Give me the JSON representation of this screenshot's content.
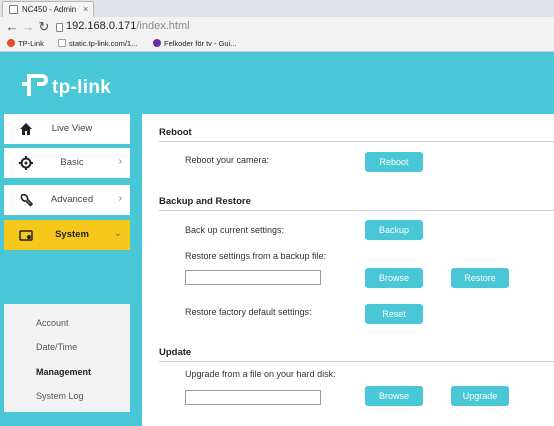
{
  "browser": {
    "tab_title": "NC450 - Admin",
    "url_host": "192.168.0.171",
    "url_path": "/index.html",
    "bookmarks": [
      {
        "label": "TP-Link",
        "color": "#e64b2a"
      },
      {
        "label": "static.tp-link.com/1...",
        "color": "#9aa3ad"
      },
      {
        "label": "Felkoder för tv - Gui...",
        "color": "#6b2fa0"
      }
    ]
  },
  "logo": {
    "text": "tp-link"
  },
  "sidebar": {
    "items": [
      {
        "label": "Live View",
        "icon": "home-icon"
      },
      {
        "label": "Basic",
        "icon": "gear-icon"
      },
      {
        "label": "Advanced",
        "icon": "wrench-icon"
      },
      {
        "label": "System",
        "icon": "system-icon"
      }
    ],
    "submenu": [
      "Account",
      "Date/Time",
      "Management",
      "System Log"
    ]
  },
  "content": {
    "reboot": {
      "title": "Reboot",
      "label": "Reboot your camera:",
      "button": "Reboot"
    },
    "backup": {
      "title": "Backup and Restore",
      "backup_label": "Back up current settings:",
      "backup_button": "Backup",
      "restore_label": "Restore settings from a backup file:",
      "browse_button": "Browse",
      "restore_button": "Restore",
      "reset_label": "Restore factory default settings:",
      "reset_button": "Reset"
    },
    "update": {
      "title": "Update",
      "label": "Upgrade from a file on your hard disk:",
      "browse_button": "Browse",
      "upgrade_button": "Upgrade"
    }
  },
  "colors": {
    "accent": "#4ac7d6",
    "active_menu": "#f6c81c"
  }
}
